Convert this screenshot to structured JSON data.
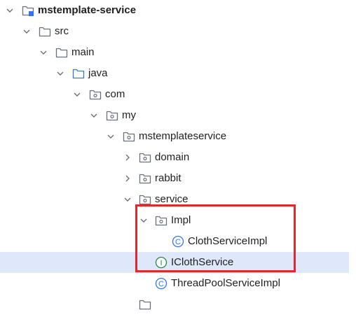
{
  "colors": {
    "folder_icon": "#6c707e",
    "source_root_icon": "#3574f0",
    "class_icon": "#3574f0",
    "interface_icon": "#208a3c",
    "selection_bg": "#dfe8fb",
    "annotation_border": "#e0282e"
  },
  "tree": {
    "items": [
      {
        "label": "mstemplate-service",
        "icon": "module-folder-icon",
        "expanded": true,
        "bold": true
      },
      {
        "label": "src",
        "icon": "folder-icon",
        "expanded": true
      },
      {
        "label": "main",
        "icon": "folder-icon",
        "expanded": true
      },
      {
        "label": "java",
        "icon": "source-root-folder-icon",
        "expanded": true
      },
      {
        "label": "com",
        "icon": "package-icon",
        "expanded": true
      },
      {
        "label": "my",
        "icon": "package-icon",
        "expanded": true
      },
      {
        "label": "mstemplateservice",
        "icon": "package-icon",
        "expanded": true
      },
      {
        "label": "domain",
        "icon": "package-icon",
        "expanded": false
      },
      {
        "label": "rabbit",
        "icon": "package-icon",
        "expanded": false
      },
      {
        "label": "service",
        "icon": "package-icon",
        "expanded": true
      },
      {
        "label": "Impl",
        "icon": "package-icon",
        "expanded": true
      },
      {
        "label": "ClothServiceImpl",
        "icon": "class-icon"
      },
      {
        "label": "IClothService",
        "icon": "interface-icon",
        "selected": true
      },
      {
        "label": "ThreadPoolServiceImpl",
        "icon": "class-icon"
      }
    ],
    "icon_glyphs": {
      "class": "C",
      "interface": "I"
    }
  }
}
